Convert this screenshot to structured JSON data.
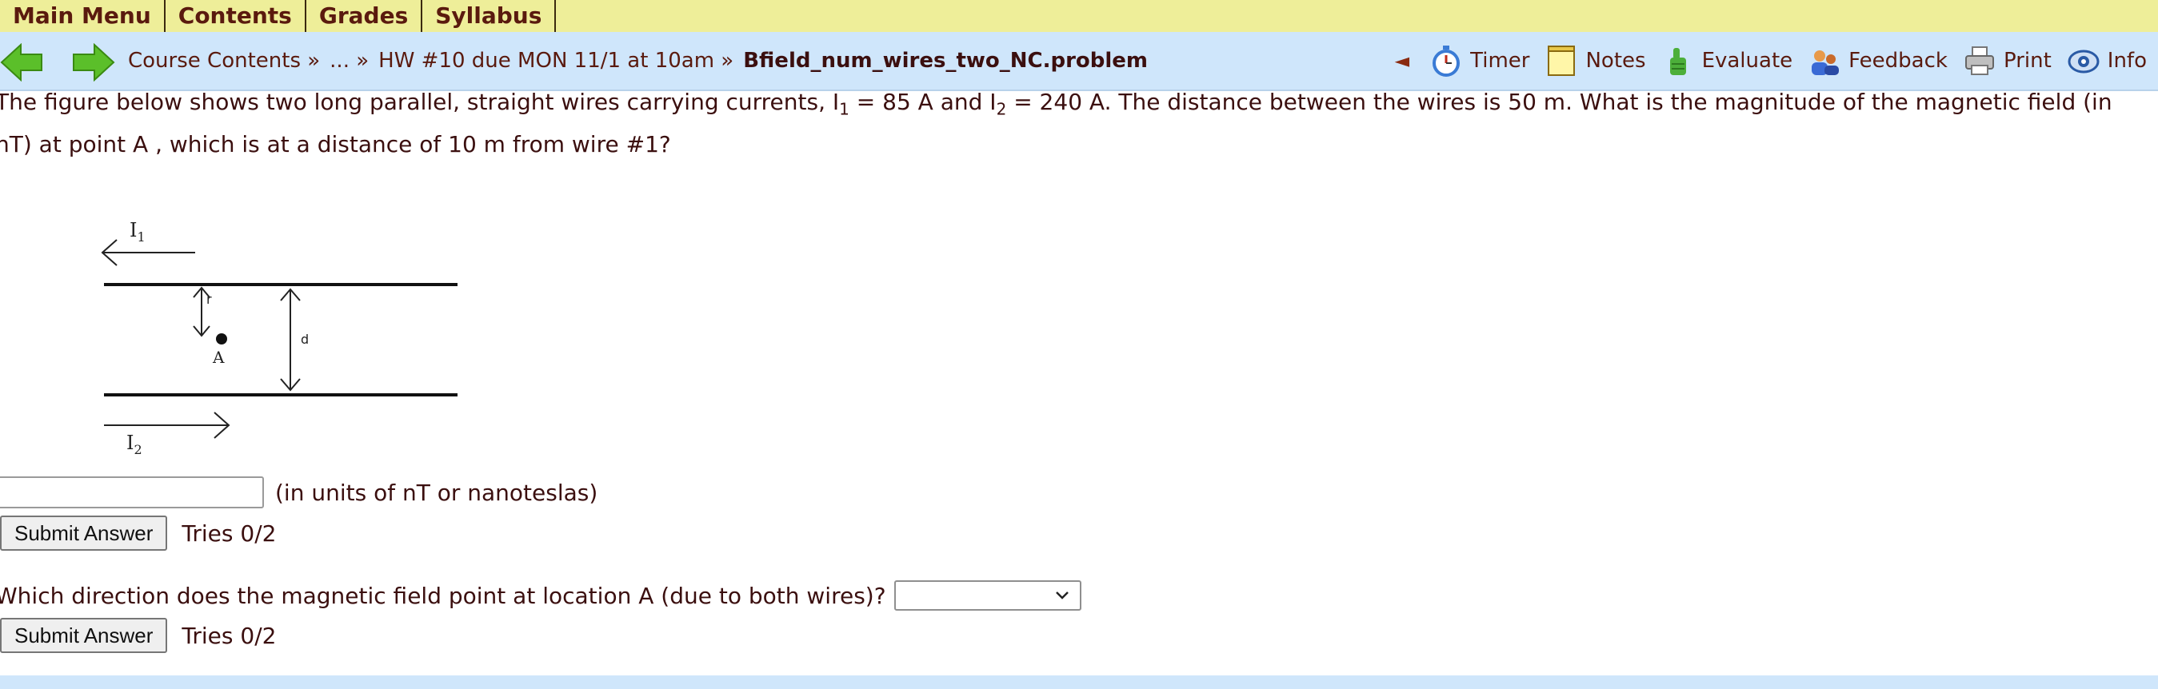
{
  "menu": {
    "items": [
      "Main Menu",
      "Contents",
      "Grades",
      "Syllabus"
    ]
  },
  "nav": {
    "breadcrumbs": [
      "Course Contents »",
      "... »",
      "HW #10 due MON 11/1 at 10am »"
    ],
    "current_problem": "Bfield_num_wires_two_NC.problem",
    "tools": {
      "timer": "Timer",
      "notes": "Notes",
      "evaluate": "Evaluate",
      "feedback": "Feedback",
      "print": "Print",
      "info": "Info"
    }
  },
  "question": {
    "part1": "The figure below shows two long parallel, straight wires carrying currents, I",
    "sub1": "1",
    "part2": " = 85 A and I",
    "sub2": "2",
    "part3": " = 240 A. The distance between the wires is 50 m. What is the magnitude of the magnetic field (in nT) at point A , which is at a distance of 10 m from wire #1?"
  },
  "figure": {
    "label_i1": "I",
    "label_i1_sub": "1",
    "label_i2": "I",
    "label_i2_sub": "2",
    "label_r": "r",
    "label_d": "d",
    "label_a": "A"
  },
  "answer1": {
    "value": "",
    "units": "(in units of nT or nanoteslas)"
  },
  "submit1": {
    "label": "Submit Answer",
    "tries": "Tries 0/2"
  },
  "question2": {
    "text": "Which direction does the magnetic field point at location A (due to both wires)?",
    "selected": ""
  },
  "submit2": {
    "label": "Submit Answer",
    "tries": "Tries 0/2"
  },
  "colors": {
    "menubar": "#eeee99",
    "navbar": "#cfe6fb",
    "text": "#3b0f0f",
    "arrow_green": "#5bbf2a"
  }
}
